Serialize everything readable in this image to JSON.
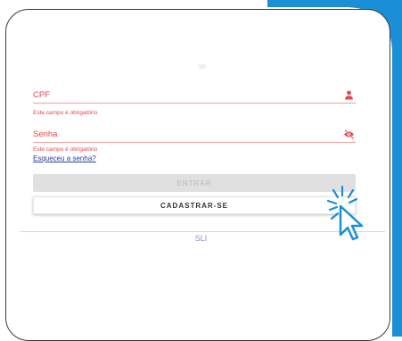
{
  "colors": {
    "accent_blue": "#1b8fd6",
    "error_red": "#e3484e",
    "link_blue": "#2a3f9c",
    "footer_text": "#7f8fc0"
  },
  "form": {
    "cpf": {
      "label": "CPF",
      "error": "Este campo é obrigatório",
      "icon": "person-icon"
    },
    "password": {
      "label": "Senha",
      "error": "Este campo é obrigatório",
      "icon": "eye-off-icon"
    },
    "forgot_password": "Esqueceu a senha?",
    "submit_label": "ENTRAR",
    "register_label": "CADASTRAR-SE"
  },
  "footer": {
    "text": "SLI"
  },
  "decoration": {
    "cursor_icon": "click-cursor-icon"
  }
}
